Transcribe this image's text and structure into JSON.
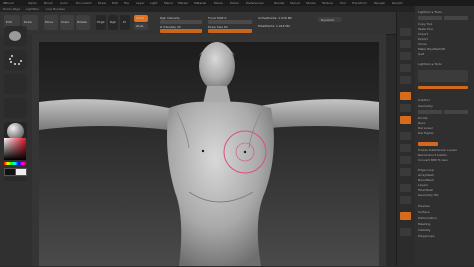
{
  "menubar": {
    "items": [
      "ZBrush",
      "Alpha",
      "Brush",
      "Color",
      "Document",
      "Draw",
      "Edit",
      "File",
      "Layer",
      "Light",
      "Macro",
      "Marker",
      "Material",
      "Movie",
      "Picker",
      "Preferences",
      "Render",
      "Stencil",
      "Stroke",
      "Texture",
      "Tool",
      "Transform",
      "Zplugin",
      "Zscript"
    ]
  },
  "subbar": {
    "labels": [
      "Home Page",
      "LightBox",
      "Live Boolean"
    ]
  },
  "shelf": {
    "edit_label": "Edit",
    "draw_label": "Draw",
    "move_label": "Move",
    "scale_label": "Scale",
    "rotate_label": "Rotate",
    "mrgb_label": "Mrgb",
    "rgb_label": "Rgb",
    "m_label": "M",
    "zadd_label": "Zadd",
    "zsub_label": "Zsub",
    "focal_label": "Focal Shift 0",
    "draw_size_label": "Draw Size 64",
    "rgb_intensity_label": "Rgb Intensity",
    "z_intensity_label": "Z Intensity 25",
    "active_points_label": "ActivePoints: 1.016 Mil",
    "total_points_label": "TotalPoints: 1.016 Mil",
    "dynamic_label": "Dynamic"
  },
  "canvas": {
    "title": "",
    "accent": "#d86c1d",
    "brush_ring_color": "#d9507a"
  },
  "righttray": {
    "rows": [
      "Lightbox ▸ Tools",
      "Load Tool",
      "Save As",
      "Copy Tool",
      "Paste Tool",
      "Import",
      "Export",
      "Clone",
      "Make PolyMesh3D",
      "GoZ",
      "All",
      "Visible",
      "R",
      "Lightbox ▸ Tools",
      "SubTool",
      "Geometry",
      "Lower Res",
      "Higher Res",
      "Divide",
      "Smt",
      "Suv",
      "Reuv",
      "Del Lower",
      "Del Higher",
      "Freeze SubDivision Levels",
      "Reconstruct Subdiv",
      "Convert BPR To Geo",
      "Edge Loop",
      "ArrayMesh",
      "NanoMesh",
      "Layers",
      "FiberMesh",
      "Geometry HD",
      "Preview",
      "Surface",
      "Deformation",
      "Masking",
      "Visibility",
      "Polygroups"
    ]
  }
}
